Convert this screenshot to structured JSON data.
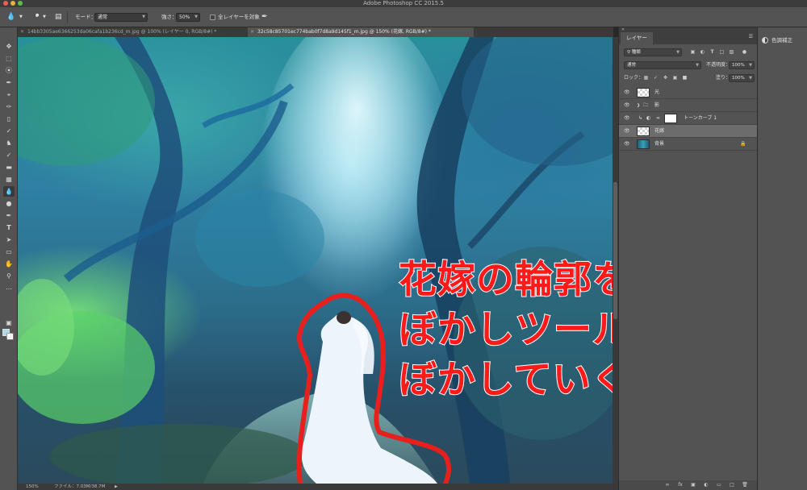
{
  "window": {
    "title": "Adobe Photoshop CC 2015.5"
  },
  "options_bar": {
    "mode_label": "モード：",
    "mode_value": "通常",
    "strength_label": "強さ：",
    "strength_value": "50%",
    "sample_all_label": "全レイヤーを対象",
    "brush_size": "8"
  },
  "tabs": [
    {
      "label": "14bb3305ae6366253da06cafa1b236cd_m.jpg @ 100% (レイヤー 0, RGB/8#) *",
      "active": false
    },
    {
      "label": "32c58c85701ec774bab0f7d8a9d145f1_m.jpg @ 150% (花嫁, RGB/8#) *",
      "active": true
    }
  ],
  "overlay_text": {
    "line1": "花嫁の輪郭を",
    "line2": "ぼかしツールで",
    "line3": "ぼかしていく"
  },
  "status_bar": {
    "zoom": "150%",
    "file_info": "ファイル：7.03M/38.7M"
  },
  "layers_panel": {
    "tab_label": "レイヤー",
    "filter_kind": "種類",
    "blend_mode": "通常",
    "opacity_label": "不透明度：",
    "opacity_value": "100%",
    "lock_label": "ロック：",
    "fill_label": "塗り：",
    "fill_value": "100%",
    "layers": [
      {
        "name": "光",
        "type": "layer"
      },
      {
        "name": "影",
        "type": "group"
      },
      {
        "name": "トーンカーブ 1",
        "type": "adjustment"
      },
      {
        "name": "花嫁",
        "type": "layer",
        "selected": true
      },
      {
        "name": "背景",
        "type": "background",
        "locked": true
      }
    ]
  },
  "dock": {
    "item_label": "色調補正"
  },
  "colors": {
    "accent_text": "#ff1a1a",
    "foreground": "#a9dce4",
    "background": "#ffffff",
    "outline_stroke": "#e8201d"
  }
}
